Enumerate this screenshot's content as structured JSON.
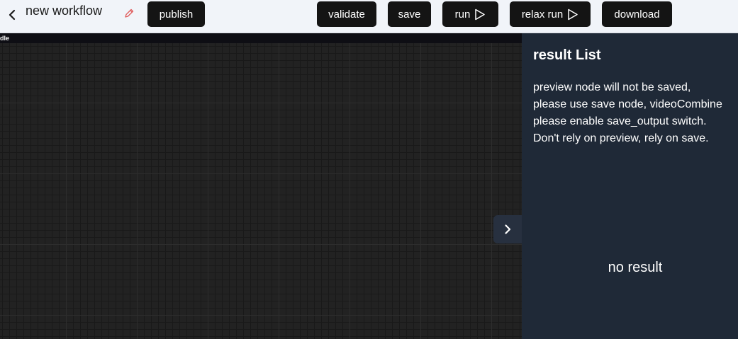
{
  "header": {
    "title": "new workflow",
    "buttons": {
      "publish": "publish",
      "validate": "validate",
      "save": "save",
      "run": "run",
      "relax_run": "relax run",
      "download": "download"
    }
  },
  "canvas": {
    "tab_label": "dle"
  },
  "result_panel": {
    "title": "result List",
    "notice_lines": [
      "preview node will not be saved,",
      "please use save node, videoCombine",
      "please enable save_output switch.",
      "Don't rely on preview, rely on save."
    ],
    "empty_text": "no result"
  },
  "icons": {
    "back": "chevron-left-icon",
    "edit": "pencil-icon",
    "run": "play-outline-icon",
    "toggle": "chevron-right-icon"
  },
  "colors": {
    "topbar_bg": "#f1f4f9",
    "button_bg": "#141414",
    "panel_bg": "#1f2937",
    "canvas_bg": "#222222",
    "edit_icon": "#e05a5a"
  }
}
